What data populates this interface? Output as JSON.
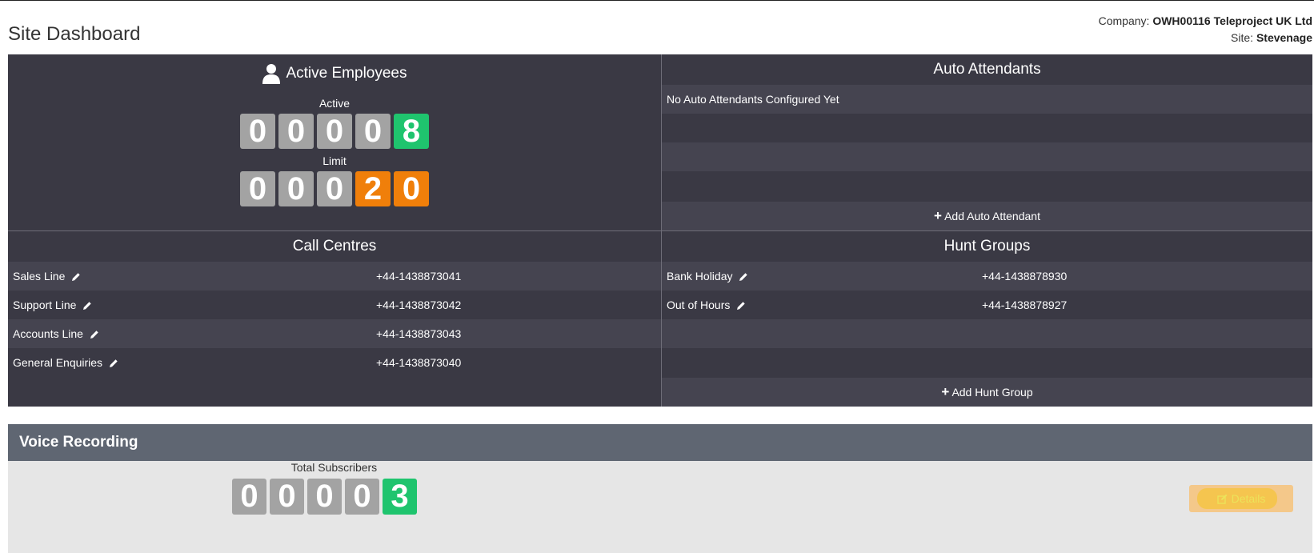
{
  "page": {
    "title": "Site Dashboard"
  },
  "company": {
    "company_label": "Company:",
    "company_value": "OWH00116 Teleproject UK Ltd",
    "site_label": "Site:",
    "site_value": "Stevenage"
  },
  "employees": {
    "title": "Active Employees",
    "active_label": "Active",
    "active_digits": [
      "0",
      "0",
      "0",
      "0",
      "8"
    ],
    "limit_label": "Limit",
    "limit_digits": [
      "0",
      "0",
      "0",
      "2",
      "0"
    ]
  },
  "auto_attendants": {
    "title": "Auto Attendants",
    "empty_message": "No Auto Attendants Configured Yet",
    "add_label": "Add Auto Attendant"
  },
  "call_centres": {
    "title": "Call Centres",
    "rows": [
      {
        "name": "Sales Line",
        "number": "+44-1438873041"
      },
      {
        "name": "Support Line",
        "number": "+44-1438873042"
      },
      {
        "name": "Accounts Line",
        "number": "+44-1438873043"
      },
      {
        "name": "General Enquiries",
        "number": "+44-1438873040"
      }
    ]
  },
  "hunt_groups": {
    "title": "Hunt Groups",
    "rows": [
      {
        "name": "Bank Holiday",
        "number": "+44-1438878930"
      },
      {
        "name": "Out of Hours",
        "number": "+44-1438878927"
      }
    ],
    "add_label": "Add Hunt Group"
  },
  "voice_recording": {
    "title": "Voice Recording",
    "subscribers_label": "Total Subscribers",
    "subscriber_digits": [
      "0",
      "0",
      "0",
      "0",
      "3"
    ],
    "details_label": "Details"
  },
  "colors": {
    "panel": "#3a3944",
    "panel_alt_row": "#454450",
    "digit_grey": "#a3a3a3",
    "digit_green": "#1fc46e",
    "digit_orange": "#f07f0a",
    "vr_header": "#5f6672"
  }
}
